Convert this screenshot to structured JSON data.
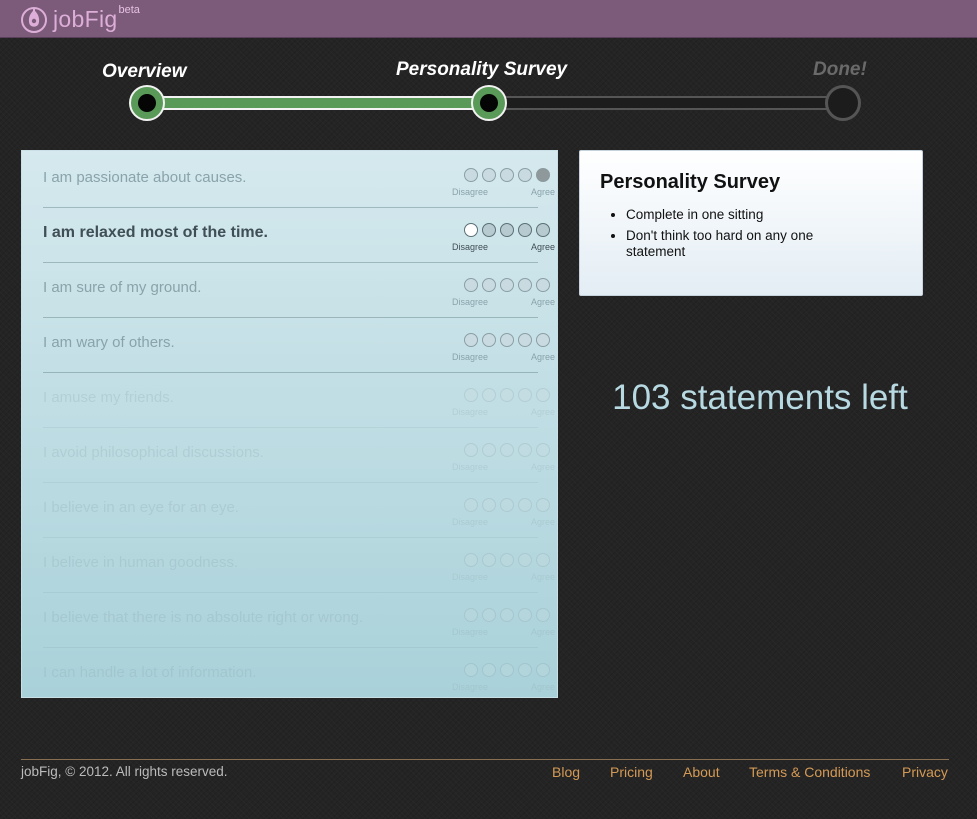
{
  "brand": {
    "name": "jobFig",
    "badge": "beta"
  },
  "progress": {
    "steps": [
      {
        "label": "Overview",
        "state": "complete"
      },
      {
        "label": "Personality Survey",
        "state": "current"
      },
      {
        "label": "Done!",
        "state": "pending"
      }
    ]
  },
  "survey": {
    "scale_left_label": "Disagree",
    "scale_right_label": "Agree",
    "statements": [
      {
        "text": "I am passionate about causes.",
        "state": "answered",
        "answer": 5
      },
      {
        "text": "I am relaxed most of the time.",
        "state": "active",
        "answer": null
      },
      {
        "text": "I am sure of my ground.",
        "state": "upcoming",
        "answer": null
      },
      {
        "text": "I am wary of others.",
        "state": "upcoming",
        "answer": null
      },
      {
        "text": "I amuse my friends.",
        "state": "faded",
        "answer": null
      },
      {
        "text": "I avoid philosophical discussions.",
        "state": "faded",
        "answer": null
      },
      {
        "text": "I believe in an eye for an eye.",
        "state": "faded",
        "answer": null
      },
      {
        "text": "I believe in human goodness.",
        "state": "faded",
        "answer": null
      },
      {
        "text": "I believe that there is no absolute right or wrong.",
        "state": "faded",
        "answer": null
      },
      {
        "text": "I can handle a lot of information.",
        "state": "faded",
        "answer": null
      }
    ]
  },
  "info_card": {
    "title": "Personality Survey",
    "bullets": [
      "Complete in one sitting",
      "Don't think too hard on any one statement"
    ]
  },
  "remaining": "103 statements left",
  "footer": {
    "copyright": "jobFig, © 2012. All rights reserved.",
    "links": [
      "Blog",
      "Pricing",
      "About",
      "Terms & Conditions",
      "Privacy"
    ]
  },
  "colors": {
    "header": "#7b5a7a",
    "accent_green": "#5a9a58",
    "link": "#d49a55"
  }
}
